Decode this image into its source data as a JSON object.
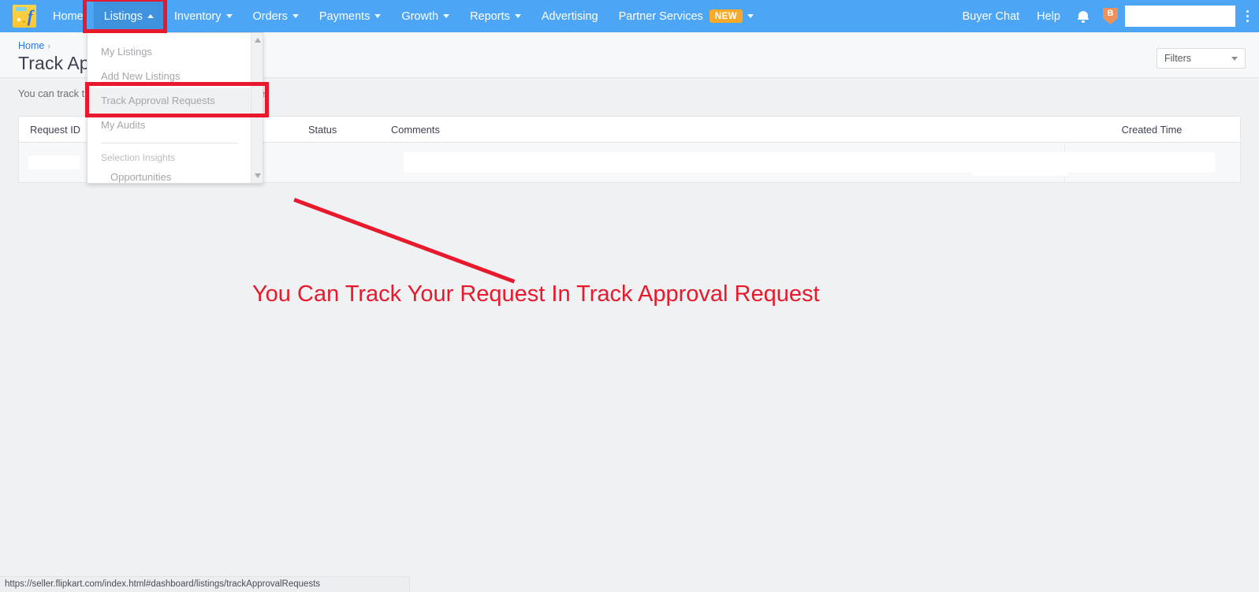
{
  "navbar": {
    "logo_alt": "flipkart-logo",
    "items": [
      {
        "label": "Home",
        "has_caret": false,
        "active": false
      },
      {
        "label": "Listings",
        "has_caret": true,
        "caret_up": true,
        "active": true
      },
      {
        "label": "Inventory",
        "has_caret": true,
        "caret_up": false,
        "active": false
      },
      {
        "label": "Orders",
        "has_caret": true,
        "caret_up": false,
        "active": false
      },
      {
        "label": "Payments",
        "has_caret": true,
        "caret_up": false,
        "active": false
      },
      {
        "label": "Growth",
        "has_caret": true,
        "caret_up": false,
        "active": false
      },
      {
        "label": "Reports",
        "has_caret": true,
        "caret_up": false,
        "active": false
      },
      {
        "label": "Advertising",
        "has_caret": false,
        "active": false
      },
      {
        "label": "Partner Services",
        "has_caret": true,
        "caret_up": false,
        "active": false,
        "badge": "NEW"
      }
    ],
    "partner_services_badge": "NEW",
    "right_items": [
      {
        "label": "Buyer Chat"
      },
      {
        "label": "Help"
      }
    ],
    "bell_icon": "notification-bell-icon",
    "shield_badge": "B",
    "kebab_icon": "vertical-dots-menu-icon",
    "background_color": "#4da6f5",
    "active_background_color": "#3f92de"
  },
  "dropdown": {
    "items": [
      {
        "label": "My Listings",
        "type": "item"
      },
      {
        "label": "Add New Listings",
        "type": "item"
      },
      {
        "label": "Track Approval Requests",
        "type": "item",
        "highlighted": true
      },
      {
        "label": "My Audits",
        "type": "item"
      },
      {
        "label": "Selection Insights",
        "type": "section"
      },
      {
        "label": "Opportunities",
        "type": "sub"
      }
    ],
    "scroll_up_icon": "scroll-up-arrow-icon",
    "scroll_down_icon": "scroll-down-arrow-icon"
  },
  "page_header": {
    "breadcrumb": "Home",
    "breadcrumb_separator": "›",
    "title": "Track Approval Requests",
    "filters_label": "Filters",
    "filters_caret_icon": "chevron-down-icon"
  },
  "info": {
    "text": "You can track the status of your approval requests here."
  },
  "table": {
    "columns": [
      "Request ID",
      "",
      "Status",
      "Comments",
      "Created Time"
    ],
    "rows": [
      {
        "request_id": "",
        "col2": "",
        "status": "",
        "comments": "",
        "created_time": ""
      }
    ]
  },
  "annotation": {
    "text": "You Can Track Your Request In Track Approval Request",
    "color": "#e8192c",
    "box_listings": "highlight-box-listings-nav",
    "box_track": "highlight-box-track-approval-requests",
    "arrow": "pointer-line"
  },
  "statusbar": {
    "url": "https://seller.flipkart.com/index.html#dashboard/listings/trackApprovalRequests"
  }
}
